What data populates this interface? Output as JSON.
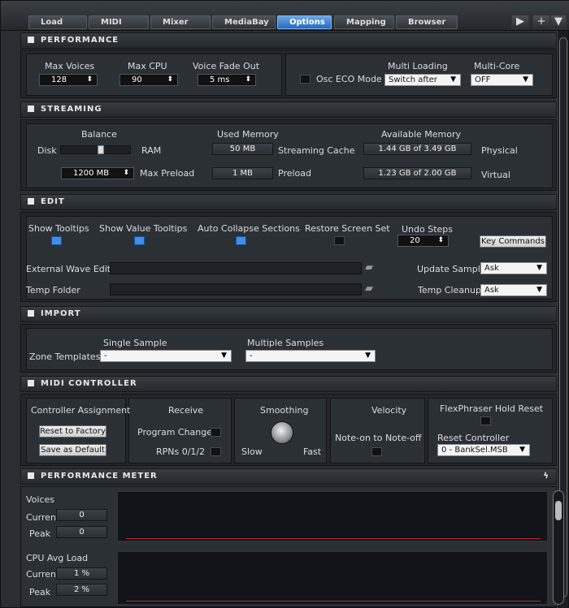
{
  "tabs": [
    {
      "label": "Load",
      "active": false
    },
    {
      "label": "MIDI",
      "active": false
    },
    {
      "label": "Mixer",
      "active": false
    },
    {
      "label": "MediaBay",
      "active": false
    },
    {
      "label": "Options",
      "active": true
    },
    {
      "label": "Mapping",
      "active": false
    },
    {
      "label": "Browser",
      "active": false
    }
  ],
  "top_buttons": {
    "play": "▶",
    "add": "+",
    "menu": "▼"
  },
  "performance": {
    "title": "PERFORMANCE",
    "max_voices_label": "Max Voices",
    "max_voices": "128",
    "max_cpu_label": "Max CPU",
    "max_cpu": "90",
    "voice_fade_label": "Voice Fade Out",
    "voice_fade": "5 ms",
    "osc_eco_label": "Osc ECO Mode",
    "multi_loading_label": "Multi Loading",
    "multi_loading": "Switch after",
    "multi_core_label": "Multi-Core",
    "multi_core": "OFF"
  },
  "streaming": {
    "title": "STREAMING",
    "balance_label": "Balance",
    "disk_label": "Disk",
    "ram_label": "RAM",
    "used_memory_label": "Used Memory",
    "available_memory_label": "Available Memory",
    "streaming_cache": "50 MB",
    "streaming_cache_label": "Streaming Cache",
    "physical": "1.44 GB of 3.49 GB",
    "physical_label": "Physical",
    "max_preload_value": "1200 MB",
    "max_preload_label": "Max Preload",
    "preload": "1 MB",
    "preload_label": "Preload",
    "virtual": "1.23 GB of 2.00 GB",
    "virtual_label": "Virtual"
  },
  "edit": {
    "title": "EDIT",
    "show_tooltips": "Show Tooltips",
    "show_value_tooltips": "Show Value Tooltips",
    "auto_collapse": "Auto Collapse Sections",
    "restore_screen_set": "Restore Screen Set",
    "undo_steps_label": "Undo Steps",
    "undo_steps": "20",
    "key_commands": "Key Commands",
    "external_wave_editor": "External Wave Editor",
    "temp_folder": "Temp Folder",
    "update_sample_label": "Update Sample",
    "update_sample": "Ask",
    "temp_cleanup_label": "Temp Cleanup",
    "temp_cleanup": "Ask"
  },
  "import": {
    "title": "IMPORT",
    "zone_templates": "Zone Templates",
    "single_sample": "Single Sample",
    "single_value": "-",
    "multiple_samples": "Multiple Samples",
    "multiple_value": "-"
  },
  "midi": {
    "title": "MIDI CONTROLLER",
    "controller_assignment": "Controller Assignment",
    "reset_to_factory": "Reset to Factory",
    "save_as_default": "Save as Default",
    "receive": "Receive",
    "program_changes": "Program Changes",
    "rpns": "RPNs 0/1/2",
    "smoothing": "Smoothing",
    "slow": "Slow",
    "fast": "Fast",
    "velocity": "Velocity",
    "note_on_to_off": "Note-on to Note-off",
    "flexphraser": "FlexPhraser Hold Reset",
    "reset_controller": "Reset Controller",
    "reset_controller_value": "0 - BankSel.MSB"
  },
  "meter": {
    "title": "PERFORMANCE METER",
    "voices_label": "Voices",
    "voices_current_label": "Current",
    "voices_current": "0",
    "voices_peak_label": "Peak",
    "voices_peak": "0",
    "cpu_label": "CPU Avg Load",
    "cpu_current_label": "Current",
    "cpu_current": "1 %",
    "cpu_peak_label": "Peak",
    "cpu_peak": "2 %"
  }
}
